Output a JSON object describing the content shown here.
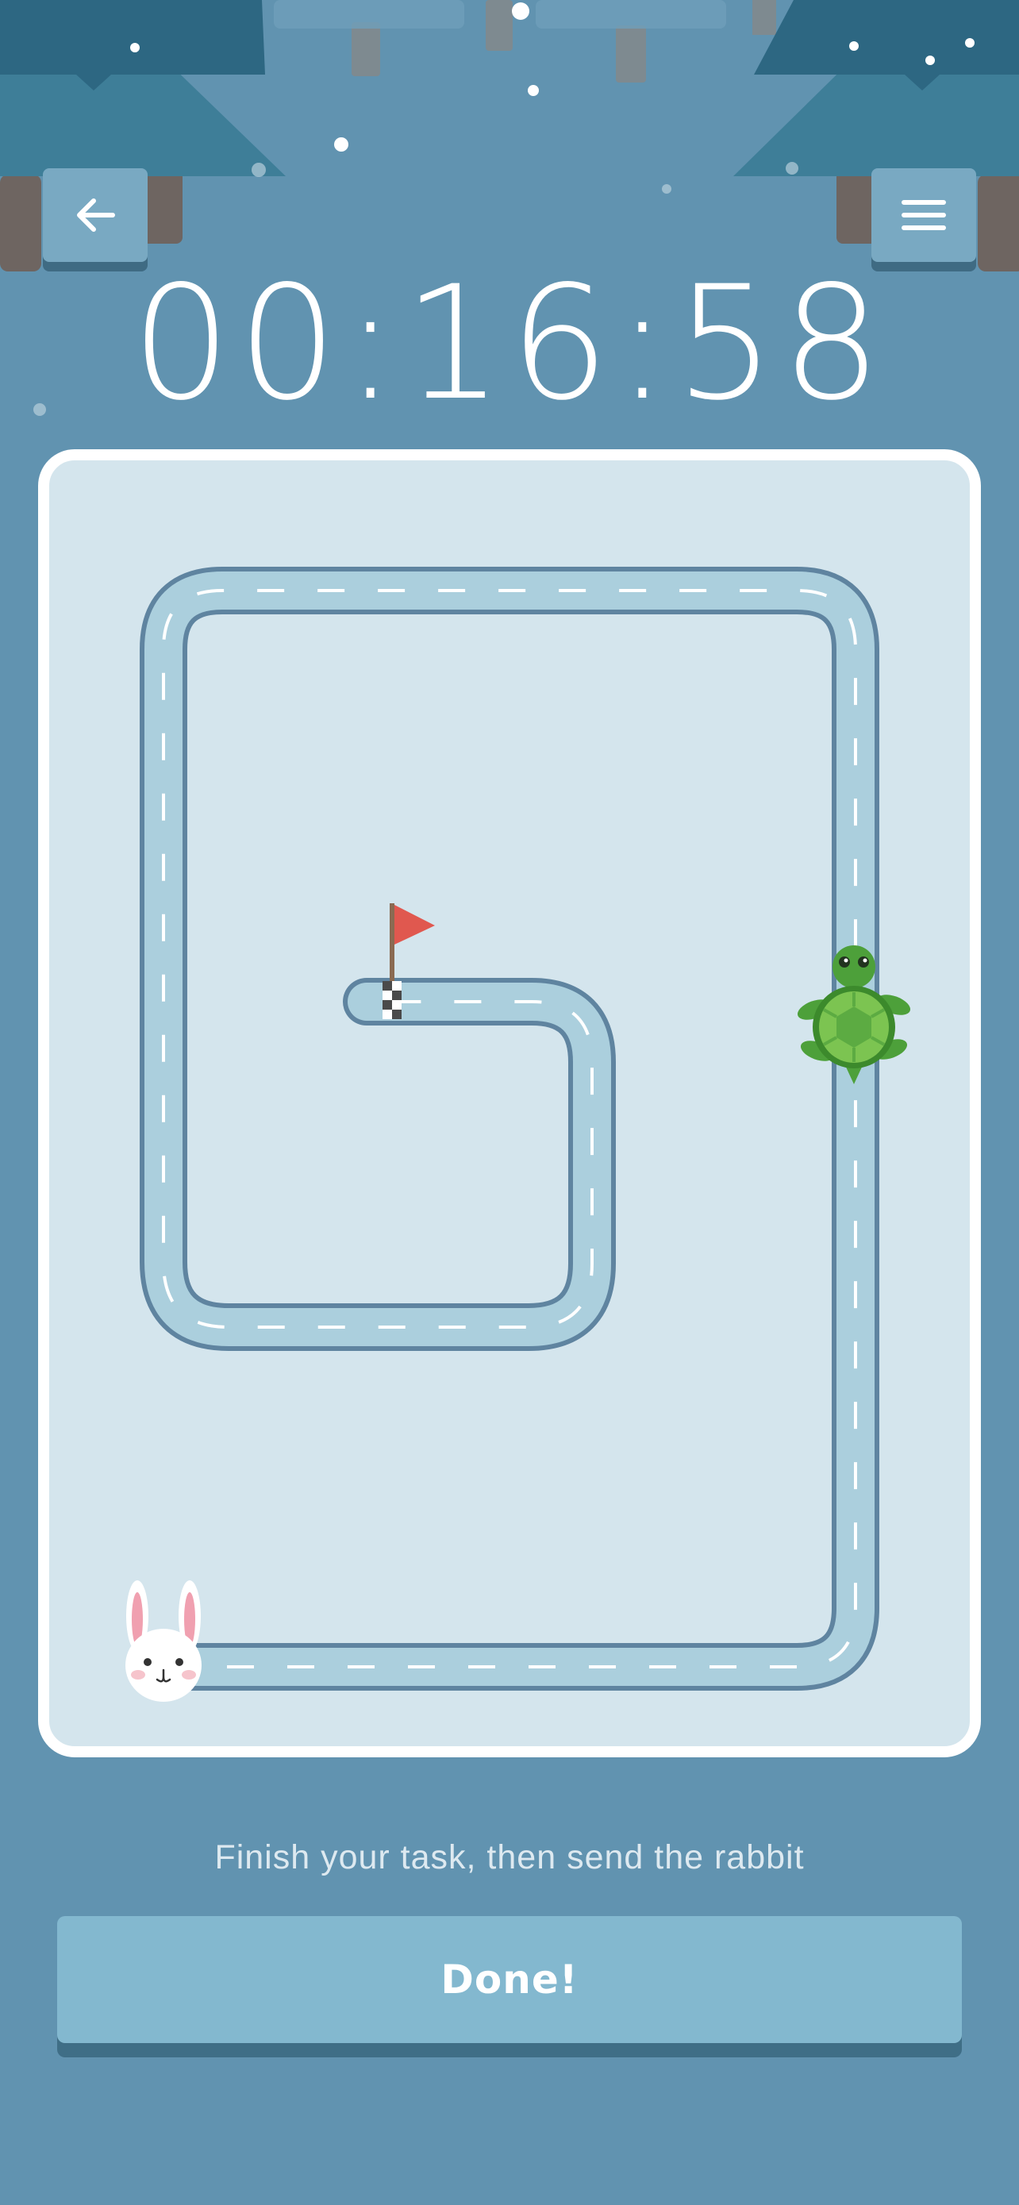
{
  "timer": {
    "value": "00:16:58"
  },
  "header": {
    "back_icon": "arrow-left-icon",
    "menu_icon": "hamburger-menu-icon"
  },
  "track": {
    "start_character": "rabbit",
    "finish_marker": "red-flag",
    "progress_character": "turtle"
  },
  "instruction": {
    "text": "Finish your task, then send the rabbit"
  },
  "done_button": {
    "label": "Done!"
  },
  "colors": {
    "background": "#6193b0",
    "board": "#d4e5ed",
    "track_fill": "#abcfdd",
    "track_edge": "#5f84a0",
    "button": "#83b8cf",
    "flag": "#e0584f",
    "turtle": "#4da03a"
  }
}
